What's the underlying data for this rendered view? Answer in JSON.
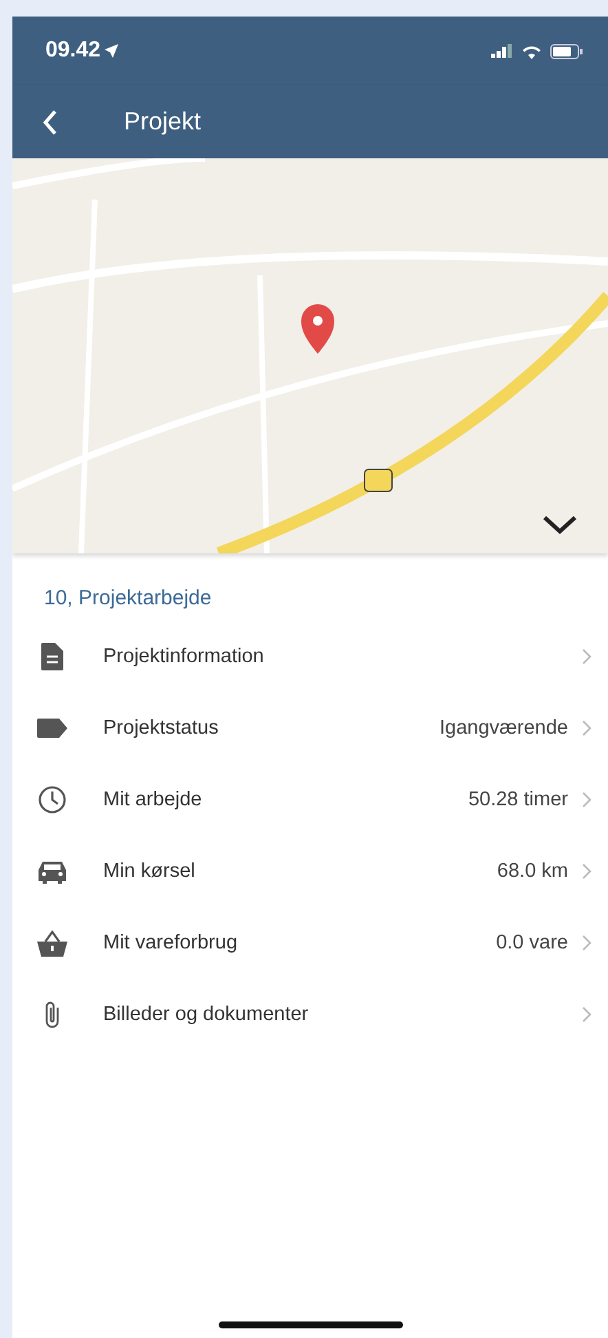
{
  "status_bar": {
    "time": "09.42"
  },
  "nav_bar": {
    "title": "Projekt"
  },
  "project": {
    "heading": "10, Projektarbejde"
  },
  "rows": [
    {
      "label": "Projektinformation"
    },
    {
      "label": "Projektstatus",
      "value": "Igangværende"
    },
    {
      "label": "Mit arbejde",
      "value": "50.28 timer"
    },
    {
      "label": "Min kørsel",
      "value": "68.0 km"
    },
    {
      "label": "Mit vareforbrug",
      "value": "0.0 vare"
    },
    {
      "label": "Billeder og dokumenter"
    }
  ]
}
